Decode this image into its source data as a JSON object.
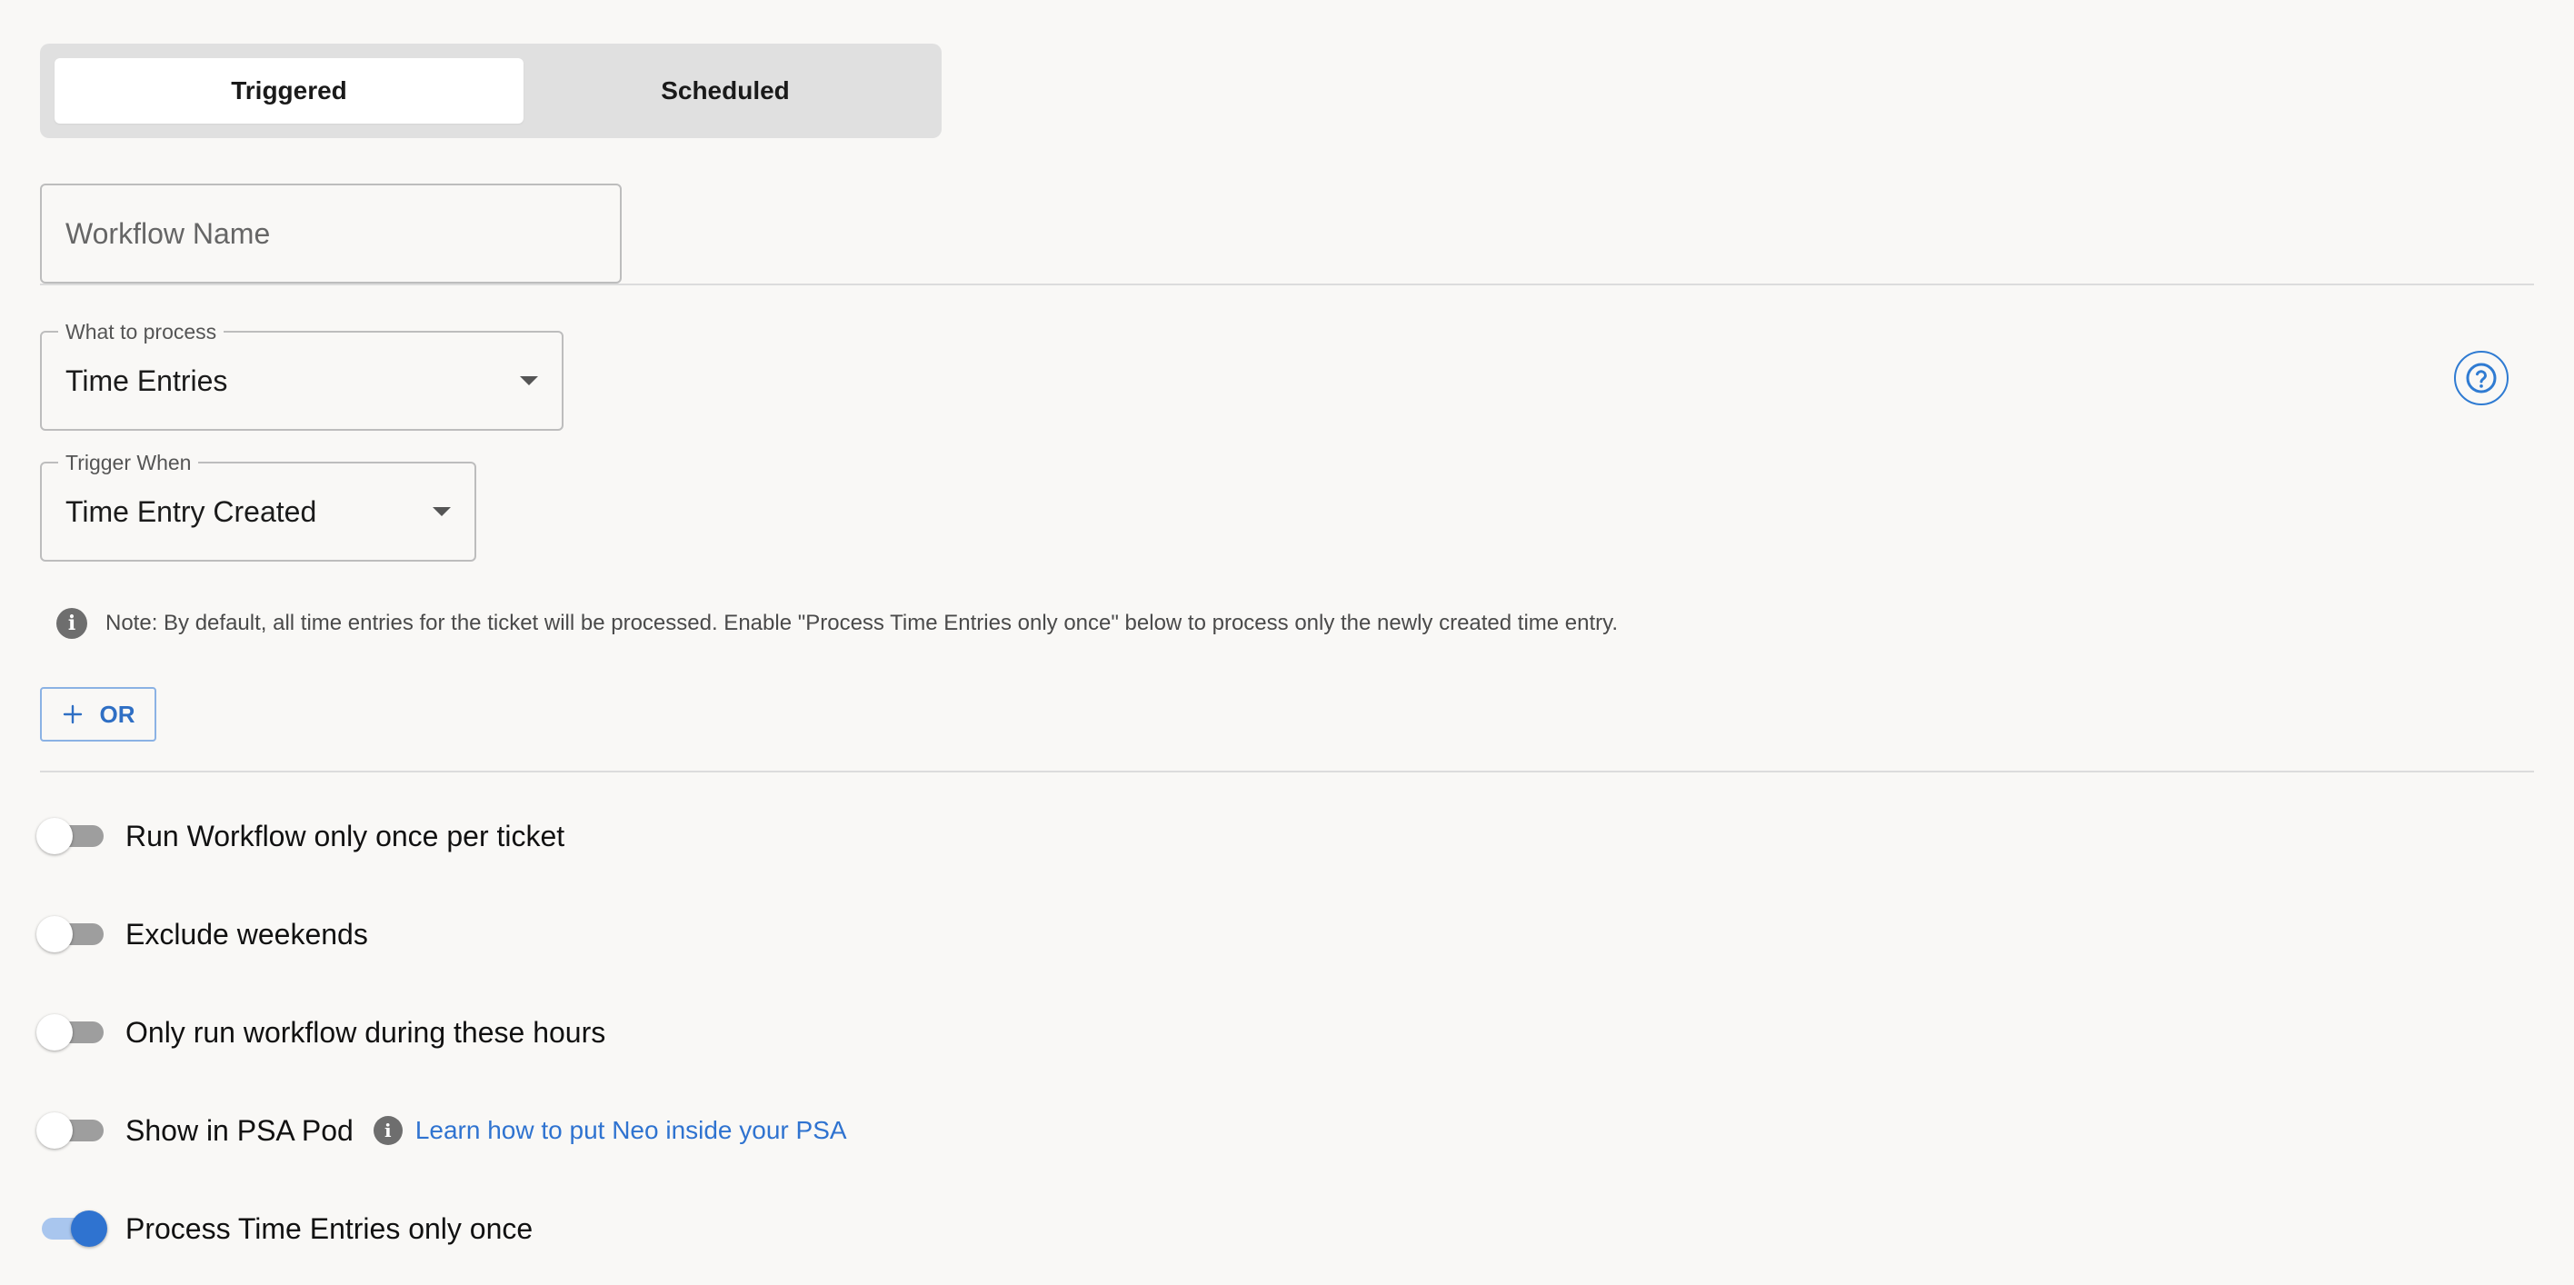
{
  "tabs": {
    "triggered_label": "Triggered",
    "scheduled_label": "Scheduled",
    "active": "Triggered"
  },
  "workflow_name": {
    "placeholder": "Workflow Name",
    "value": ""
  },
  "what_to_process": {
    "label": "What to process",
    "value": "Time Entries"
  },
  "trigger_when": {
    "label": "Trigger When",
    "value": "Time Entry Created"
  },
  "note": {
    "text": "Note: By default, all time entries for the ticket will be processed. Enable \"Process Time Entries only once\" below to process only the newly created time entry."
  },
  "or_button": {
    "label": "OR"
  },
  "toggles": [
    {
      "label": "Run Workflow only once per ticket",
      "on": false
    },
    {
      "label": "Exclude weekends",
      "on": false
    },
    {
      "label": "Only run workflow during these hours",
      "on": false
    },
    {
      "label": "Show in PSA Pod",
      "on": false,
      "link_text": "Learn how to put Neo inside your PSA"
    },
    {
      "label": "Process Time Entries only once",
      "on": true
    }
  ],
  "icons": {
    "help": "help-circle-icon",
    "info": "info-icon",
    "plus": "plus-icon",
    "caret": "caret-down-icon"
  },
  "colors": {
    "accent": "#2f73d0",
    "background": "#f9f8f6",
    "segmented_bg": "#e0e0e0",
    "toggle_off_track": "#9e9e9e",
    "toggle_on_track": "#a9c6ee"
  }
}
